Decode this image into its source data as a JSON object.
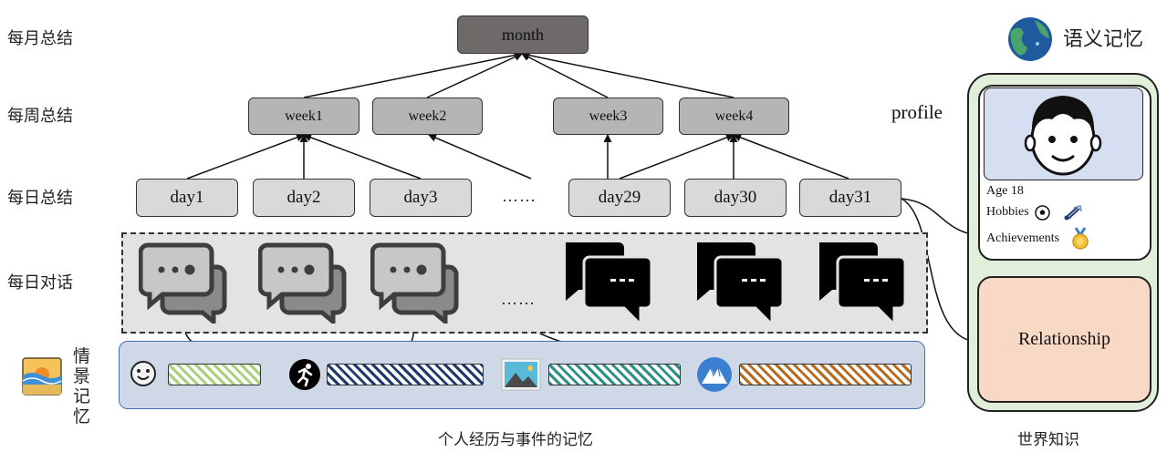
{
  "row_labels": {
    "monthly": "每月总结",
    "weekly": "每周总结",
    "daily": "每日总结",
    "dialogue": "每日对话",
    "episodic": "情景记忆"
  },
  "nodes": {
    "month": "month",
    "weeks": [
      "week1",
      "week2",
      "week3",
      "week4"
    ],
    "days": [
      "day1",
      "day2",
      "day3",
      "day29",
      "day30",
      "day31"
    ],
    "day_ellipsis": "……",
    "chat_ellipsis": "……"
  },
  "captions": {
    "episodic": "个人经历与事件的记忆",
    "world": "世界知识"
  },
  "semantic": {
    "title": "语义记忆",
    "profile_label": "profile",
    "age": "Age 18",
    "hobbies": "Hobbies",
    "achievements": "Achievements",
    "relationship": "Relationship"
  },
  "colors": {
    "day_fill": "#d9d9d9",
    "week_fill": "#b7b4b4",
    "month_fill": "#6e6a6a",
    "chat_panel": "#e3e3e3",
    "episodic_panel": "#cfd8e6",
    "side_panel": "#e1eed9",
    "relationship_fill": "#f8d9c6",
    "avatar_bg": "#d6dff2",
    "bar_green": "#9bc86a",
    "bar_navy": "#1f3a6e",
    "bar_teal": "#2e8f84",
    "bar_orange": "#b86a1e"
  },
  "icons": {
    "chat_light": "speech-bubbles-outline-icon",
    "chat_dark": "speech-bubbles-filled-icon",
    "smile": "smiley-face-icon",
    "runner": "running-person-icon",
    "landscape": "landscape-photo-icon",
    "mountain": "mountain-icon",
    "beach": "beach-sunset-icon",
    "globe": "earth-globe-icon",
    "soccer": "soccer-ball-icon",
    "badminton": "shuttlecock-icon",
    "medal": "medal-icon"
  }
}
